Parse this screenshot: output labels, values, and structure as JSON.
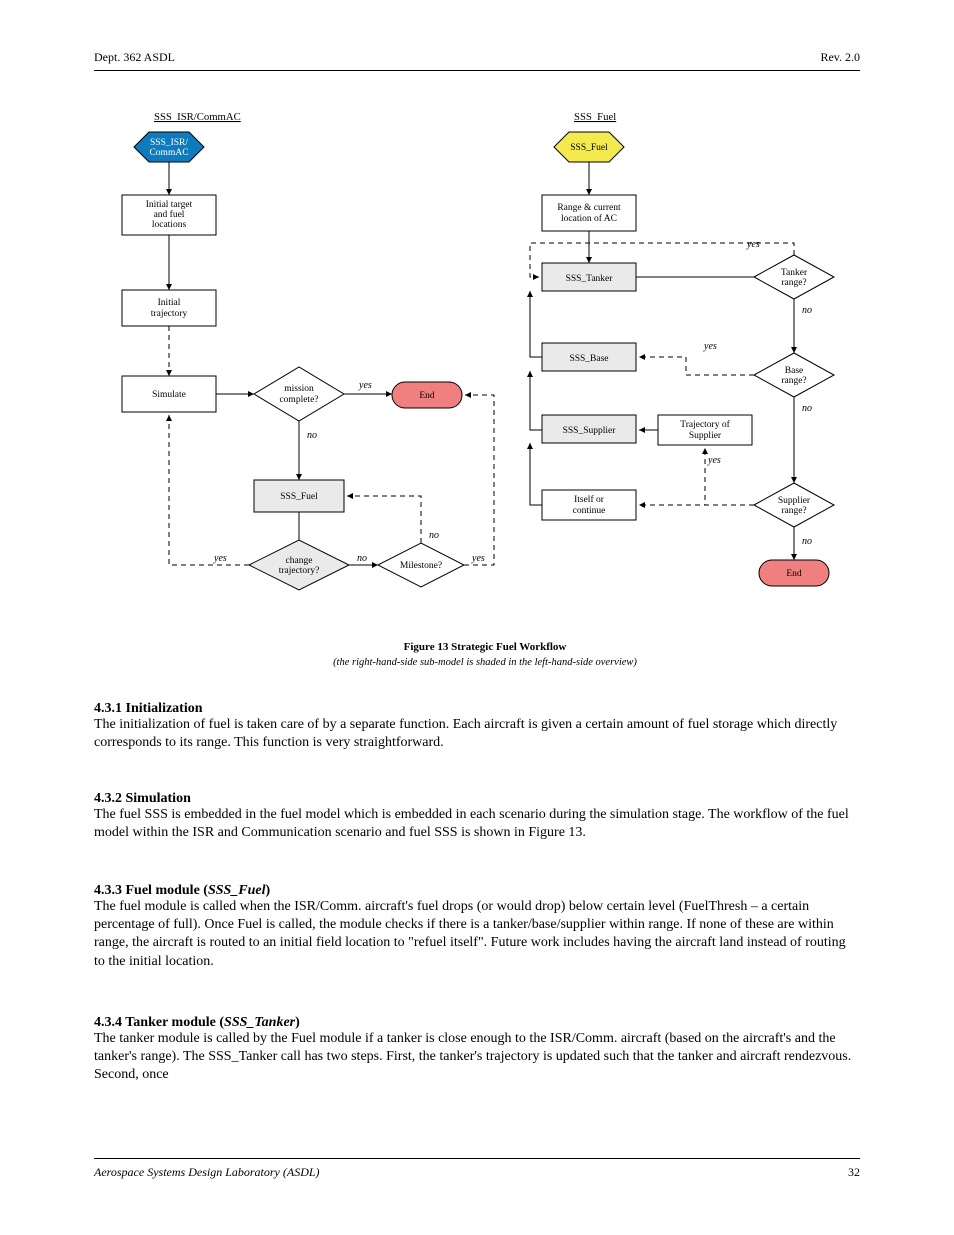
{
  "header": {
    "dept": "Dept. 362 ASDL",
    "rev": "Rev. 2.0"
  },
  "footer": {
    "left": "Aerospace Systems Design Laboratory (ASDL)",
    "right": "32"
  },
  "fig": {
    "leftTitle": "SSS_ISR/CommAC",
    "rightTitle": "SSS_Fuel",
    "caption": "Figure 13  Strategic Fuel Workflow",
    "subcaption": "(the right-hand-side sub-model is shaded in the left-hand-side overview)",
    "left": {
      "hex": "SSS_ISR/\nCommAC",
      "box1": "Initial target\nand fuel\nlocations",
      "box2": "Initial\ntrajectory",
      "box3": "Simulate",
      "d1": "mission\ncomplete?",
      "end": "End",
      "sub": "SSS_Fuel",
      "d2": "change\ntrajectory?",
      "d3": "Milestone?",
      "yes1": "yes",
      "no1": "no",
      "yes2": "yes",
      "no2": "no",
      "yes3": "yes",
      "no3": "no"
    },
    "right": {
      "hex": "SSS_Fuel",
      "box1": "Range & current\nlocation of AC",
      "sub1": "SSS_Tanker",
      "d1": "Tanker\nrange?",
      "sub2": "SSS_Base",
      "d2": "Base\nrange?",
      "sub3": "SSS_Supplier",
      "box2": "Trajectory of\nSupplier",
      "d3": "Supplier\nrange?",
      "box3": "Itself or\ncontinue",
      "end": "End",
      "yes1": "yes",
      "no1": "no",
      "yes2": "yes",
      "no2": "no",
      "yes3": "yes",
      "no3": "no"
    }
  },
  "sections": {
    "s1num": "4.3.1",
    "s1title": "  Initialization",
    "s1body": "The initialization of fuel is taken care of by a separate function. Each aircraft is given a certain amount of fuel storage which directly corresponds to its range. This function is very straightforward.",
    "s2num": "4.3.2",
    "s2title": "  Simulation",
    "s2body": "The fuel SSS is embedded in the fuel model which is embedded in each scenario during the simulation stage. The workflow of the fuel model within the ISR and Communication scenario and fuel SSS is shown in Figure 13.",
    "s3num": "4.3.3",
    "s3title": "  Fuel module (",
    "s3title_ital": "SSS_Fuel",
    "s3title_end": ")",
    "s3body": "The fuel module is called when the ISR/Comm. aircraft's fuel drops (or would drop) below certain level (FuelThresh – a certain percentage of full). Once Fuel is called, the module checks if there is a tanker/base/supplier within range. If none of these are within range, the aircraft is routed to an initial field location to \"refuel itself\". Future work includes having the aircraft land instead of routing to the initial location.",
    "s4num": "4.3.4",
    "s4title": "  Tanker module (",
    "s4title_ital": "SSS_Tanker",
    "s4title_end": ")",
    "s4body": "The tanker module is called by the Fuel module if a tanker is close enough to the ISR/Comm. aircraft (based on the aircraft's and the tanker's range). The SSS_Tanker call has two steps. First, the tanker's trajectory is updated such that the tanker and aircraft rendezvous. Second, once"
  }
}
